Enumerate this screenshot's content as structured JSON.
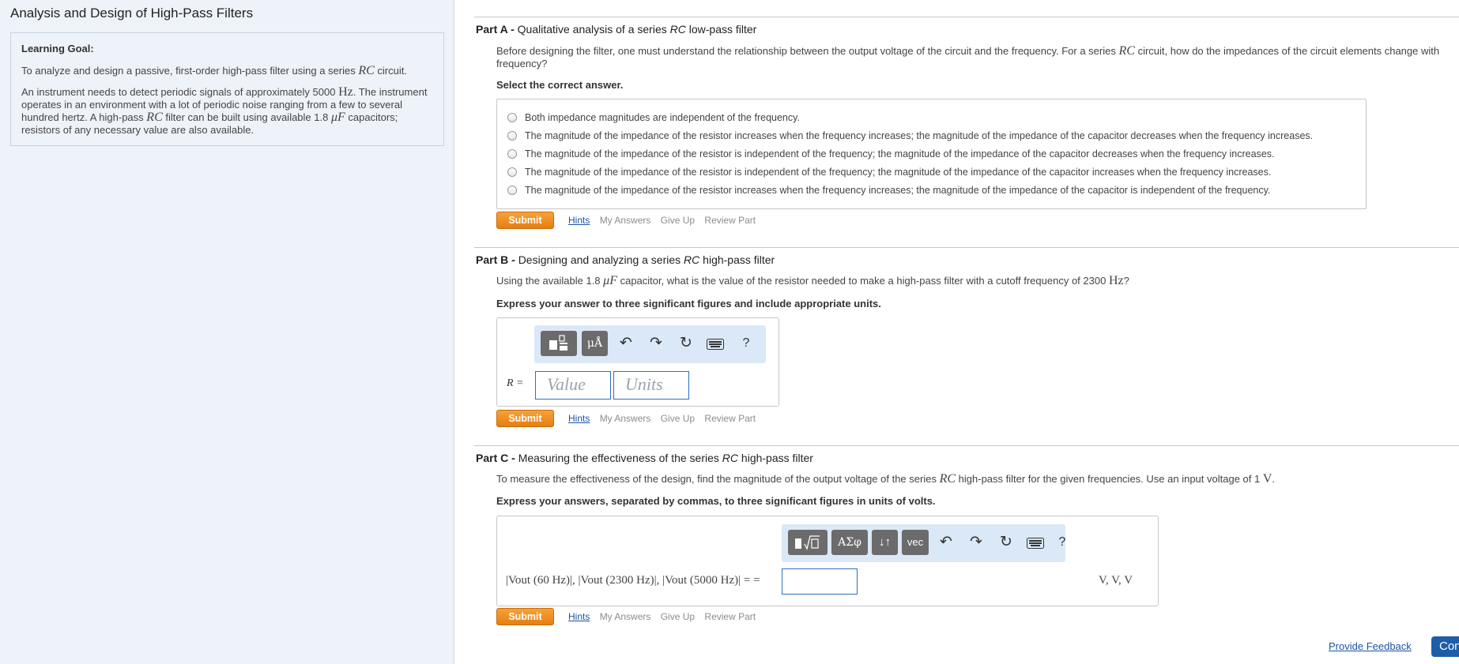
{
  "problem": {
    "title": "Analysis and Design of High-Pass Filters",
    "learning_goal_heading": "Learning Goal:",
    "learning_goal_pre": "To analyze and design a passive, first-order high-pass filter using a series",
    "rc": "RC",
    "learning_goal_post": "circuit.",
    "instrument_1": "An instrument needs to detect periodic signals of approximately 5000",
    "hz": "Hz",
    "instrument_2": ". The instrument operates in an environment with a lot of periodic noise ranging from a few to several hundred hertz. A high-pass",
    "instrument_3": "filter can be built using available 1.8",
    "uF": "μF",
    "instrument_4": "capacitors; resistors of any necessary value are also available."
  },
  "part_a": {
    "label": "Part A -",
    "title_pre": "Qualitative analysis of a series",
    "title_rc": "RC",
    "title_post": "low-pass filter",
    "prompt_1": "Before designing the filter, one must understand the relationship between the output voltage of the circuit and the frequency. For a series",
    "prompt_2": "circuit, how do the impedances of the circuit elements change with frequency?",
    "instruction": "Select the correct answer.",
    "choices": [
      "Both impedance magnitudes are independent of the frequency.",
      "The magnitude of the impedance of the resistor increases when the frequency increases; the magnitude of the impedance of the capacitor decreases when the frequency increases.",
      "The magnitude of the impedance of the resistor is independent of the frequency; the magnitude of the impedance of the capacitor decreases when the frequency increases.",
      "The magnitude of the impedance of the resistor is independent of the frequency; the magnitude of the impedance of the capacitor increases when the frequency increases.",
      "The magnitude of the impedance of the resistor increases when the frequency increases; the magnitude of the impedance of the capacitor is independent of the frequency."
    ]
  },
  "part_b": {
    "label": "Part B -",
    "title_pre": "Designing and analyzing a series",
    "title_rc": "RC",
    "title_post": "high-pass filter",
    "prompt_1": "Using the available 1.8",
    "prompt_uF": "μF",
    "prompt_2": "capacitor, what is the value of the resistor needed to make a high-pass filter with a cutoff frequency of 2300",
    "prompt_hz": "Hz",
    "prompt_end": "?",
    "instruction": "Express your answer to three significant figures and include appropriate units.",
    "var_label": "R =",
    "value_placeholder": "Value",
    "units_placeholder": "Units",
    "toolbar": {
      "units_btn": "μÅ",
      "help": "?"
    }
  },
  "part_c": {
    "label": "Part C -",
    "title_pre": "Measuring the effectiveness of the series",
    "title_rc": "RC",
    "title_post": "high-pass filter",
    "prompt_1": "To measure the effectiveness of the design, find the magnitude of the output voltage of the series",
    "prompt_rc": "RC",
    "prompt_2": "high-pass filter for the given frequencies. Use an input voltage of 1",
    "prompt_v": "V",
    "prompt_end": ".",
    "instruction": "Express your answers, separated by commas, to three significant figures in units of volts.",
    "expression": "|Vout (60 Hz)|, |Vout (2300 Hz)|, |Vout (5000 Hz)| = =",
    "units": "V, V, V",
    "toolbar": {
      "greek_btn": "ΑΣφ",
      "arrows_btn": "↓↑",
      "vec_btn": "vec",
      "help": "?"
    }
  },
  "actions": {
    "submit": "Submit",
    "hints": "Hints",
    "my_answers": "My Answers",
    "give_up": "Give Up",
    "review_part": "Review Part"
  },
  "footer": {
    "feedback": "Provide Feedback",
    "continue": "Con"
  },
  "colors": {
    "accent_submit": "#f08c22",
    "link": "#1a55a3",
    "panel_bg": "#eef3f9",
    "toolbar_bg": "#dbe8f7"
  }
}
